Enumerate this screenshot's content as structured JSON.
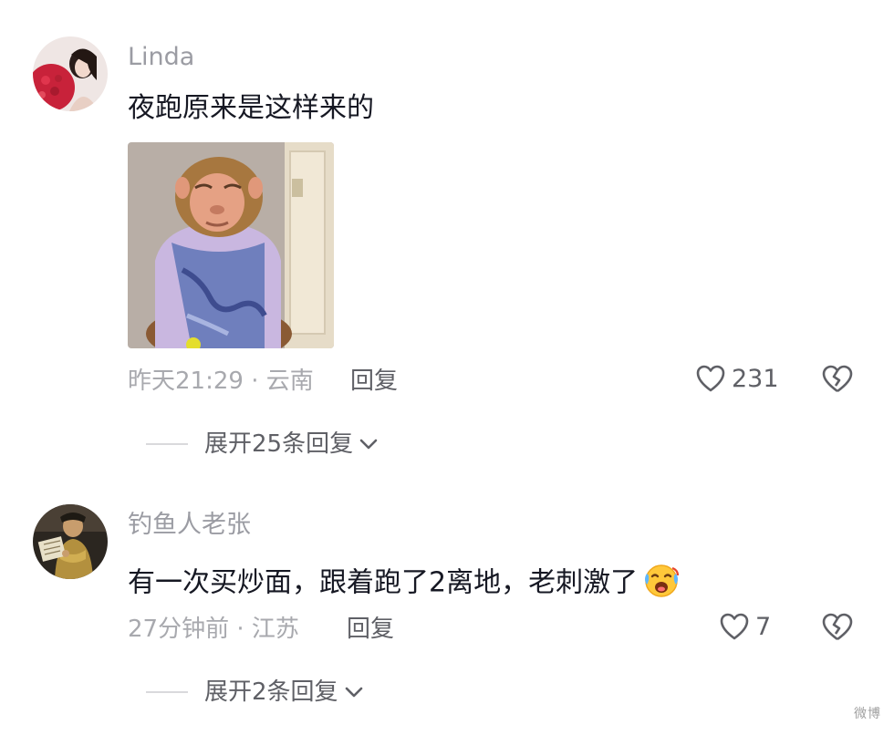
{
  "comments": [
    {
      "username": "Linda",
      "content": "夜跑原来是这样来的",
      "time": "昨天21:29",
      "separator": "·",
      "location": "云南",
      "reply_label": "回复",
      "likes": "231",
      "expand_label": "展开25条回复"
    },
    {
      "username": "钓鱼人老张",
      "content": "有一次买炒面，跟着跑了2离地，老刺激了",
      "time": "27分钟前",
      "separator": "·",
      "location": "江苏",
      "reply_label": "回复",
      "likes": "7",
      "expand_label": "展开2条回复"
    }
  ],
  "icons": {
    "like": "heart-outline-icon",
    "dislike": "broken-heart-icon",
    "expand": "chevron-down-icon",
    "emoji": "crying-laughing-face-emoji"
  },
  "colors": {
    "username": "#9b9ca3",
    "content": "#161823",
    "meta": "#a8a9ae",
    "action": "#5f6066"
  },
  "watermark": "微博"
}
